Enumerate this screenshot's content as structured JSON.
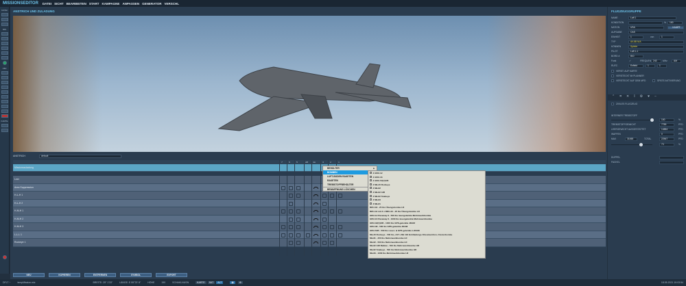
{
  "app": {
    "title": "MISSIONSEDITOR",
    "menu": [
      "DATEI",
      "SICHT",
      "BEARBEITEN",
      "START",
      "KAMPAGNE",
      "ANPASSEN",
      "GENERATOR",
      "VERSCHL"
    ]
  },
  "left_toolbar": {
    "groups": [
      "DATEI",
      "MIS",
      "OBJ",
      "KARTE"
    ]
  },
  "panel": {
    "title": "ANSTRICH UND ZULADUNG",
    "skin_label": "ANSTRICH",
    "skin_value": "default",
    "columns": [
      "7",
      "6",
      "5",
      "cl8",
      "4A",
      "3",
      "2",
      "1"
    ],
    "selected_row": "Missionszuladung",
    "rows": [
      "Leer",
      "Area Suppression",
      "H-L-H 1",
      "H-L-H 2",
      "H-M-H 1",
      "H-M-H 2",
      "H-M-H 3",
      "L-L-L 1",
      "Rockeye 1"
    ],
    "buttons": [
      "NEU",
      "KOPIEREN",
      "ENTFERNEN",
      "SYMBOL",
      "EXPORT"
    ]
  },
  "context_menu": {
    "items": [
      "BEHÄLTER",
      "BOMBEN",
      "LUFT-BODEN RAKETEN",
      "RAKETEN",
      "TREIBSTOFFBEHÄLTER",
      "BEWAFFNUNG LÖSCHEN"
    ],
    "active": "BOMBEN"
  },
  "submenu": {
    "items": [
      "2 GBU-12",
      "2 GBU-16",
      "2 GBU-54(V)1/B",
      "2 Mk-20 Rockeye",
      "2 Mk-82",
      "2 Mk-82 AIR",
      "2 Mk-82 Snakeye",
      "2 Mk-83",
      "3 Mk-81",
      "BDU-33 - 25 lbs Übungsbombe LD",
      "BRU-42 mit 3 x BDU-33 - 25 lbs Übungsbombe LD",
      "GBU-12 Paveway II - 500 lbs lasergelenkte Mehrzweckbombe",
      "GBU-16 Paveway II - 1000 lbs lasergelenkte Mehrzweckbombe",
      "GBU-32(V)2/B - 1000 lbs GPS-gelenkte JDAM",
      "GBU-38 - 500 lbs GPS-gelenkte JDAM",
      "GBU-54B - 500 lbs Laser- & GPS-gelenkte LJDAM",
      "Mk-20 Rockeye - 500 lbs, 247 x Mk 118 Hohlladungs-Streumunition, Clusterbombe",
      "Mk-81 - 250 lbs Mehrzweckbombe LD",
      "Mk-82 - 500 lbs Mehrzweckbombe LD",
      "Mk-82 AIR Ballute - 500 lbs Mehrzweckbombe HD",
      "Mk-82 Snakeye - 500 lbs Mehrzweckbombe HD",
      "Mk-83 - 1000 lbs Mehrzweckbombe LD"
    ]
  },
  "right": {
    "title": "FLUGZEUGGRUPPE",
    "name_label": "NAME",
    "name": "Luft 1",
    "cond_label": "KONDITION",
    "cond_pct": "%",
    "cond_val": "100",
    "nation_label": "NATION",
    "nation": "USA",
    "kampf": "KAMPF",
    "task_label": "AUFGABE",
    "task": "CAS",
    "unit_label": "EINHEIT",
    "unit": "1",
    "unit_of": "von",
    "unit_total": "1",
    "type_label": "TYP",
    "type": "AV-8B N/A",
    "skill_label": "KÖNNEN",
    "skill": "Spieler",
    "pilot_label": "PILOT",
    "pilot": "Luft 1-1",
    "board_label": "BORD #",
    "board": "810",
    "radio_label": "Funk",
    "freq_label": "FREQUENZ",
    "freq": "243",
    "mhz": "MHz",
    "mod": "AM",
    "callsign_label": "RUFZ.",
    "callsign": "Enfield",
    "cs1": "1",
    "cs2": "1",
    "checks": [
      "VERST. AUF KARTE",
      "VERSTECKT IM PLANNER",
      "VERSTECKT AUF DEM MFD",
      "SPÄTE AKTIVIERUNG"
    ],
    "civil": "ZIVILES FLUGZEUG",
    "fuel_label": "INTERNER TREIBSTOFF",
    "fuel_pct": "100",
    "pct": "%",
    "fuelw_label": "TREIBSTOFFGEWICHT",
    "fuelw": "7759",
    "pfd": "PFD",
    "empty_label": "LEERGEWICHT AUSGESTATTET",
    "empty": "14884",
    "weapons_label": "WAFFEN",
    "weapons": "0",
    "max_label": "MAX",
    "max": "31065",
    "total_label": "TOTAL",
    "total": "22567",
    "load_pct": "73",
    "chaff_label": "DÜPPEL",
    "flare_label": "FACKEL"
  },
  "status": {
    "mode": "DFLT ~",
    "file": "tempMission.miz",
    "lat": "BREITE: 25° 1'33\"",
    "lon": "LÄNGE: E 55°23' 8\"",
    "alt_label": "HÖHE",
    "alt": "190",
    "layer": "SCHAKLNUSN",
    "map_buttons": [
      "KARTE",
      "SAT",
      "ALT"
    ],
    "datetime": "18.05.2021 19:03:54"
  },
  "fuel_fraction": 1.0,
  "load_fraction": 0.73
}
